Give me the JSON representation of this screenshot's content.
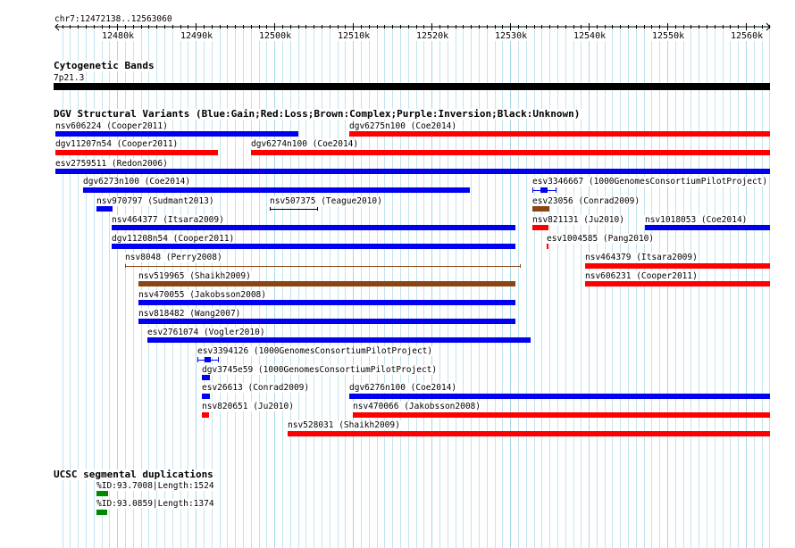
{
  "region": "chr7:12472138..12563060",
  "ticks": [
    "12480k",
    "12490k",
    "12500k",
    "12510k",
    "12520k",
    "12530k",
    "12540k",
    "12550k",
    "12560k"
  ],
  "tracks": {
    "cyto": {
      "title": "Cytogenetic Bands",
      "band": "7p21.3"
    },
    "dgv": {
      "title": "DGV Structural Variants (Blue:Gain;Red:Loss;Brown:Complex;Purple:Inversion;Black:Unknown)",
      "features": [
        {
          "label": "nsv606224 (Cooper2011)",
          "start": 12472138,
          "end": 12503000,
          "color": "gain"
        },
        {
          "label": "dgv6275n100 (Coe2014)",
          "start": 12509500,
          "end": 12563060,
          "color": "loss"
        },
        {
          "label": "dgv11207n54 (Cooper2011)",
          "start": 12472138,
          "end": 12492800,
          "color": "loss"
        },
        {
          "label": "dgv6274n100 (Coe2014)",
          "start": 12497000,
          "end": 12563060,
          "color": "loss"
        },
        {
          "label": "esv2759511 (Redon2006)",
          "start": 12472138,
          "end": 12563060,
          "color": "gain"
        },
        {
          "label": "dgv6273n100 (Coe2014)",
          "start": 12475700,
          "end": 12524900,
          "color": "gain"
        },
        {
          "label": "esv3346667 (1000GenomesConsortiumPilotProject)",
          "start": 12532800,
          "end": 12535900,
          "color": "gain",
          "style": "gene"
        },
        {
          "label": "nsv970797 (Sudmant2013)",
          "start": 12477400,
          "end": 12479400,
          "color": "gain"
        },
        {
          "label": "nsv507375 (Teague2010)",
          "start": 12499400,
          "end": 12505500,
          "color": "unknown",
          "style": "line"
        },
        {
          "label": "esv23056 (Conrad2009)",
          "start": 12532800,
          "end": 12535000,
          "color": "complex"
        },
        {
          "label": "nsv464377 (Itsara2009)",
          "start": 12479300,
          "end": 12530700,
          "color": "gain"
        },
        {
          "label": "nsv821131 (Ju2010)",
          "start": 12532800,
          "end": 12534900,
          "color": "loss"
        },
        {
          "label": "nsv1018053 (Coe2014)",
          "start": 12547200,
          "end": 12563060,
          "color": "gain"
        },
        {
          "label": "dgv11208n54 (Cooper2011)",
          "start": 12479300,
          "end": 12530700,
          "color": "gain"
        },
        {
          "label": "esv1004585 (Pang2010)",
          "start": 12534700,
          "end": 12534900,
          "color": "loss"
        },
        {
          "label": "nsv8048 (Perry2008)",
          "start": 12481000,
          "end": 12531300,
          "color": "complex",
          "style": "line"
        },
        {
          "label": "nsv464379 (Itsara2009)",
          "start": 12539500,
          "end": 12563060,
          "color": "loss"
        },
        {
          "label": "nsv519965 (Shaikh2009)",
          "start": 12482700,
          "end": 12530700,
          "color": "complex"
        },
        {
          "label": "nsv606231 (Cooper2011)",
          "start": 12539500,
          "end": 12563060,
          "color": "loss"
        },
        {
          "label": "nsv470055 (Jakobsson2008)",
          "start": 12482700,
          "end": 12530700,
          "color": "gain"
        },
        {
          "label": "nsv818482 (Wang2007)",
          "start": 12482700,
          "end": 12530700,
          "color": "gain"
        },
        {
          "label": "esv2761074 (Vogler2010)",
          "start": 12483900,
          "end": 12532700,
          "color": "gain"
        },
        {
          "label": "esv3394126 (1000GenomesConsortiumPilotProject)",
          "start": 12490200,
          "end": 12492900,
          "color": "gain",
          "style": "gene"
        },
        {
          "label": "dgv3745e59 (1000GenomesConsortiumPilotProject)",
          "start": 12490800,
          "end": 12491800,
          "color": "gain"
        },
        {
          "label": "esv26613 (Conrad2009)",
          "start": 12490800,
          "end": 12491800,
          "color": "gain"
        },
        {
          "label": "dgv6276n100 (Coe2014)",
          "start": 12509500,
          "end": 12563060,
          "color": "gain"
        },
        {
          "label": "nsv820651 (Ju2010)",
          "start": 12490800,
          "end": 12491700,
          "color": "loss"
        },
        {
          "label": "nsv470066 (Jakobsson2008)",
          "start": 12510000,
          "end": 12563060,
          "color": "loss"
        },
        {
          "label": "nsv528031 (Shaikh2009)",
          "start": 12501700,
          "end": 12563060,
          "color": "loss"
        }
      ]
    },
    "segdup": {
      "title": "UCSC segmental duplications",
      "features": [
        {
          "label": "%ID:93.7008|Length:1524",
          "start": 12477400,
          "end": 12478900,
          "color": "segdup"
        },
        {
          "label": "%ID:93.0859|Length:1374",
          "start": 12477400,
          "end": 12478800,
          "color": "segdup"
        }
      ]
    }
  },
  "colors": {
    "gain": "#0000ee",
    "loss": "#ff0000",
    "complex": "#8b4513",
    "unknown": "#000000",
    "segdup": "#008800",
    "grid": "#a8d8e8"
  }
}
